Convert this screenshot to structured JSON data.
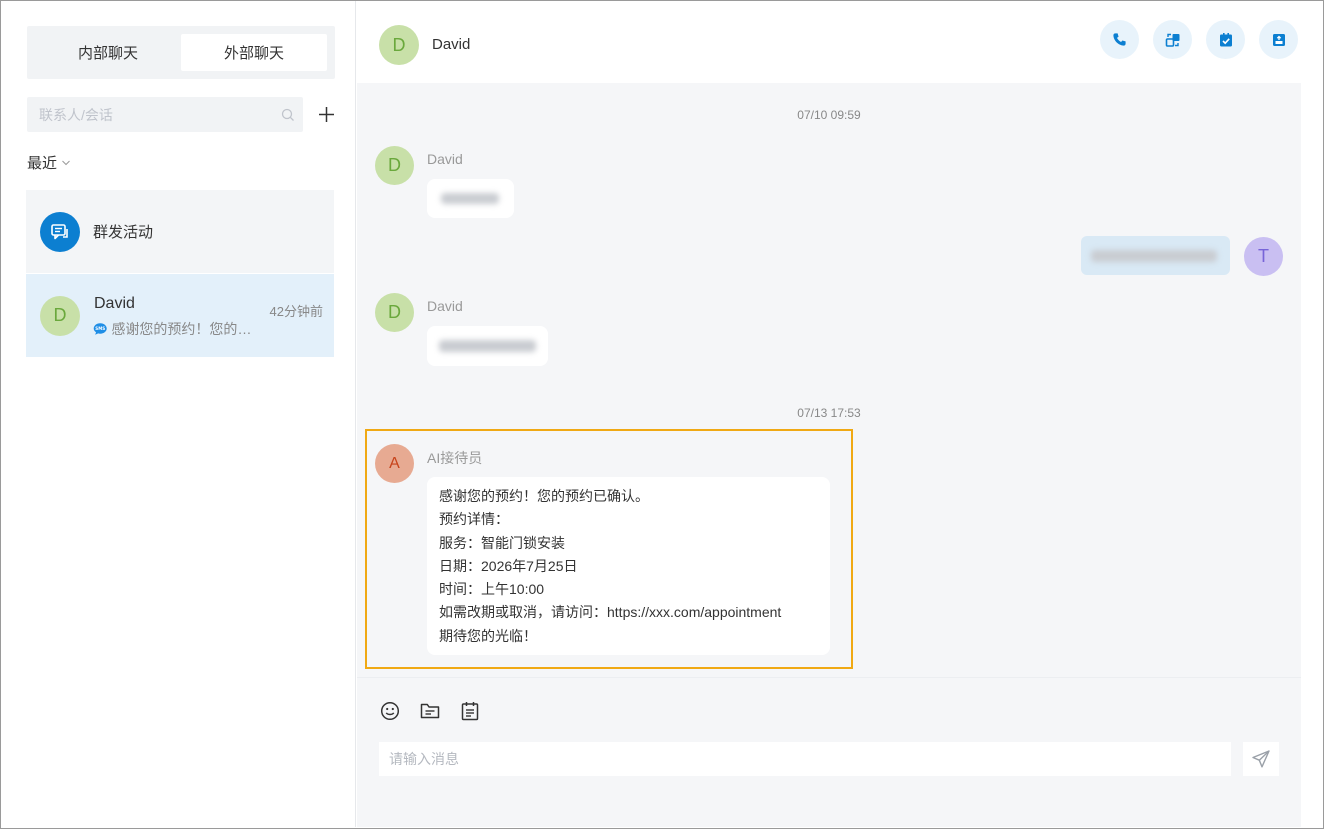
{
  "tabs": [
    {
      "label": "内部聊天",
      "active": false
    },
    {
      "label": "外部聊天",
      "active": true
    }
  ],
  "search": {
    "placeholder": "联系人/会话"
  },
  "recent_label": "最近",
  "conversations": [
    {
      "title": "群发活动",
      "icon": "broadcast-icon"
    },
    {
      "initial": "D",
      "name": "David",
      "time": "42分钟前",
      "channel_icon": "sms-icon",
      "preview": "感谢您的预约！您的预约已确认。"
    }
  ],
  "header": {
    "initial": "D",
    "name": "David",
    "actions": [
      "phone-icon",
      "transfer-icon",
      "task-check-icon",
      "archive-icon"
    ]
  },
  "messages": {
    "time1": "07/10 09:59",
    "david_initial": "D",
    "sender1": "David",
    "sender2": "David",
    "agent_initial": "T",
    "time2": "07/13 17:53",
    "ai_initial": "A",
    "ai_sender": "AI接待员",
    "ai_lines": [
      "感谢您的预约！您的预约已确认。",
      "预约详情：",
      "服务：智能门锁安装",
      "日期：2026年7月25日",
      "时间：上午10:00",
      "如需改期或取消，请访问：https://xxx.com/appointment",
      "期待您的光临！"
    ]
  },
  "composer": {
    "placeholder": "请输入消息",
    "tools": [
      "emoji-icon",
      "folder-icon",
      "template-icon"
    ]
  },
  "colors": {
    "accent": "#0c7fd1",
    "highlight": "#f0a914",
    "selected_bg": "#e3f0fa"
  }
}
